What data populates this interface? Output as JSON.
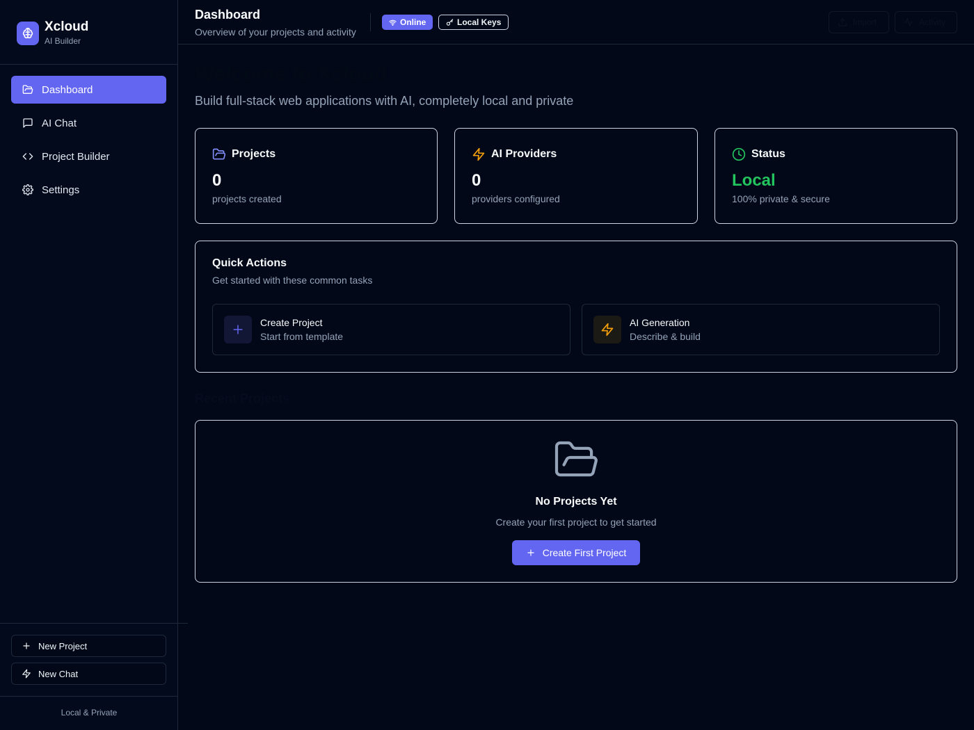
{
  "sidebar": {
    "brand_name": "Xcloud",
    "brand_sub": "AI Builder",
    "brand_icon": "brain-icon",
    "nav": [
      {
        "label": "Dashboard",
        "icon": "folder-open-icon",
        "active": true
      },
      {
        "label": "AI Chat",
        "icon": "message-square-icon",
        "active": false
      },
      {
        "label": "Project Builder",
        "icon": "code-icon",
        "active": false
      },
      {
        "label": "Settings",
        "icon": "gear-icon",
        "active": false
      }
    ],
    "actions": [
      {
        "label": "New Project",
        "icon": "plus-icon"
      },
      {
        "label": "New Chat",
        "icon": "zap-icon"
      }
    ],
    "footer": "Local & Private"
  },
  "header": {
    "title": "Dashboard",
    "subtitle": "Overview of your projects and activity",
    "badge_online": "Online",
    "badge_keys": "Local Keys",
    "btn_1": "Import",
    "btn_2": "Activity"
  },
  "main": {
    "welcome": "Welcome to Xcloud",
    "welcome_sub": "Build full-stack web applications with AI, completely local and private",
    "stats": [
      {
        "title": "Projects",
        "value": "0",
        "desc": "projects created",
        "icon": "folder-icon",
        "color": "#818cf8"
      },
      {
        "title": "AI Providers",
        "value": "0",
        "desc": "providers configured",
        "icon": "zap-icon",
        "color": "#f59e0b"
      },
      {
        "title": "Status",
        "value": "Local",
        "desc": "100% private & secure",
        "icon": "clock-icon",
        "color": "#22c55e"
      }
    ],
    "quick_actions": {
      "title": "Quick Actions",
      "subtitle": "Get started with these common tasks",
      "items": [
        {
          "title": "Create Project",
          "subtitle": "Start from template",
          "icon": "plus-icon"
        },
        {
          "title": "AI Generation",
          "subtitle": "Describe & build",
          "icon": "zap-icon"
        }
      ]
    },
    "recent_title": "Recent Projects",
    "empty": {
      "title": "No Projects Yet",
      "subtitle": "Create your first project to get started",
      "button": "Create First Project",
      "icon": "folder-open-icon"
    }
  },
  "colors": {
    "accent": "#6366f1",
    "background": "#020817",
    "success": "#22c55e",
    "warning": "#f59e0b"
  }
}
